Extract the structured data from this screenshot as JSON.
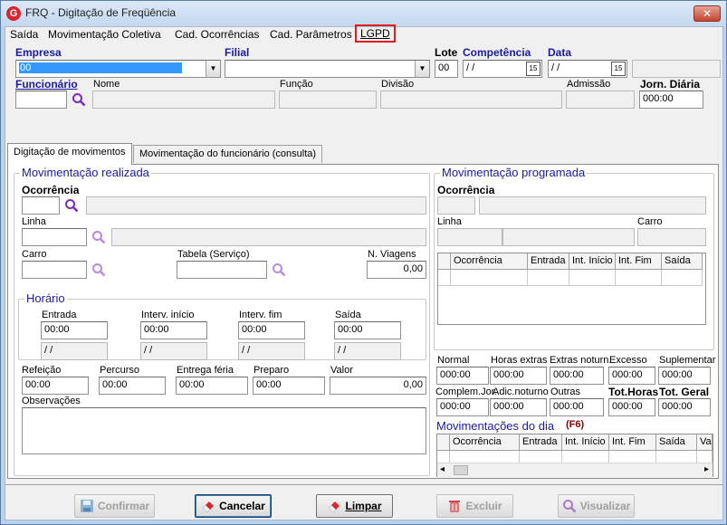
{
  "window": {
    "title": "FRQ - Digitação de Freqüência",
    "app_icon": "G",
    "close_label": "✕"
  },
  "menu": [
    {
      "label": "Saída"
    },
    {
      "label": "Movimentação Coletiva"
    },
    {
      "label": "Cad. Ocorrências"
    },
    {
      "label": "Cad. Parâmetros"
    },
    {
      "label": "LGPD"
    }
  ],
  "header": {
    "empresa_label": "Empresa",
    "empresa_value": "00",
    "filial_label": "Filial",
    "filial_value": "",
    "lote_label": "Lote",
    "lote_value": "00",
    "competencia_label": "Competência",
    "competencia_value": " / /",
    "data_label": "Data",
    "data_value": " / /",
    "funcionario_label": "Funcionário",
    "funcionario_value": "",
    "nome_label": "Nome",
    "funcao_label": "Função",
    "divisao_label": "Divisão",
    "admissao_label": "Admissão",
    "jorn_diaria_label": "Jorn. Diária",
    "jorn_diaria_value": "000:00"
  },
  "tabs": [
    {
      "label": "Digitação de movimentos",
      "active": true
    },
    {
      "label": "Movimentação do funcionário (consulta)",
      "active": false
    }
  ],
  "realizada": {
    "title": "Movimentação realizada",
    "ocorrencia_label": "Ocorrência",
    "linha_label": "Linha",
    "carro_label": "Carro",
    "tabela_label": "Tabela (Serviço)",
    "nviagens_label": "N. Viagens",
    "nviagens_value": "0,00",
    "horario_title": "Horário",
    "entrada_label": "Entrada",
    "entrada_value": "00:00",
    "interv_inicio_label": "Interv. início",
    "interv_inicio_value": "00:00",
    "interv_fim_label": "Interv. fim",
    "interv_fim_value": "00:00",
    "saida_label": "Saída",
    "saida_value": "00:00",
    "date_placeholder": " / /",
    "refeicao_label": "Refeição",
    "refeicao_value": "00:00",
    "percurso_label": "Percurso",
    "percurso_value": "00:00",
    "entrega_label": "Entrega féria",
    "entrega_value": "00:00",
    "preparo_label": "Preparo",
    "preparo_value": "00:00",
    "valor_label": "Valor",
    "valor_value": "0,00",
    "observacoes_label": "Observações"
  },
  "programada": {
    "title": "Movimentação programada",
    "ocorrencia_label": "Ocorrência",
    "linha_label": "Linha",
    "carro_label": "Carro",
    "columns": [
      "Ocorrência",
      "Entrada",
      "Int. Início",
      "Int. Fim",
      "Saída"
    ]
  },
  "totais": {
    "normal_label": "Normal",
    "normal_value": "000:00",
    "horas_extras_label": "Horas extras",
    "horas_extras_value": "000:00",
    "extras_noturn_label": "Extras noturn.",
    "extras_noturn_value": "000:00",
    "excesso_label": "Excesso",
    "excesso_value": "000:00",
    "suplementar_label": "Suplementar",
    "suplementar_value": "000:00",
    "complem_label": "Complem.Jor.",
    "complem_value": "000:00",
    "adic_noturno_label": "Adic.noturno",
    "adic_noturno_value": "000:00",
    "outras_label": "Outras",
    "outras_value": "000:00",
    "tot_horas_label": "Tot.Horas",
    "tot_horas_value": "000:00",
    "tot_geral_label": "Tot. Geral",
    "tot_geral_value": "000:00"
  },
  "dia": {
    "title": "Movimentações do dia",
    "shortcut": "(F6)",
    "columns": [
      "Ocorrência",
      "Entrada",
      "Int. Início",
      "Int. Fim",
      "Saída",
      "Va"
    ]
  },
  "buttons": {
    "confirmar": "Confirmar",
    "cancelar": "Cancelar",
    "limpar": "Limpar",
    "excluir": "Excluir",
    "visualizar": "Visualizar"
  },
  "colors": {
    "accent_blue": "#1a1aa3",
    "highlight_red": "#e21b1b",
    "selection_blue": "#3399ff"
  }
}
